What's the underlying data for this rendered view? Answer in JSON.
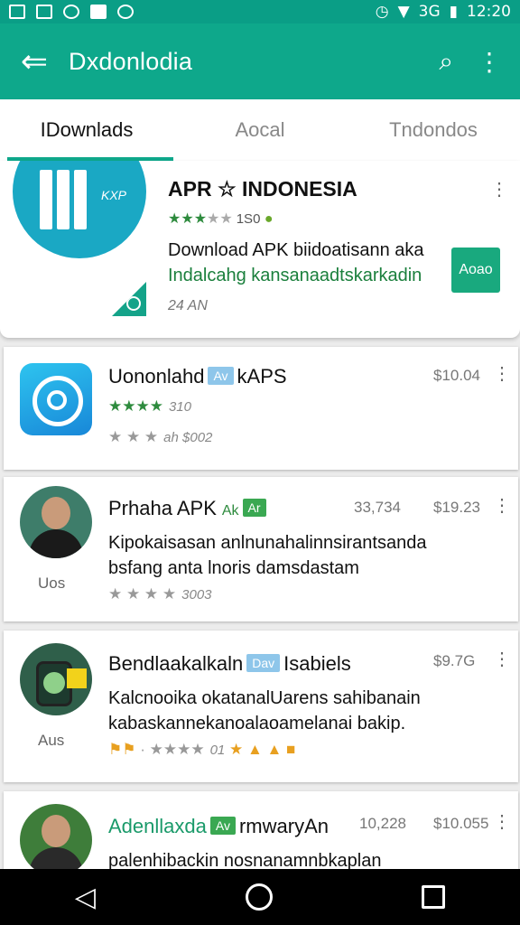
{
  "status": {
    "time": "12:20",
    "signal_text": "3G"
  },
  "appbar": {
    "title": "Dxdonlodia"
  },
  "tabs": [
    {
      "label": "IDownlads"
    },
    {
      "label": "Aocal"
    },
    {
      "label": "Tndondos"
    }
  ],
  "featured": {
    "title": "APR ☆ INDONESIA",
    "rating_count": "1S0",
    "line1": "Download APK biidoatisann aka",
    "line2": "Indalcahg kansanaadtskarkadin",
    "size": "24 AN",
    "button": "Aoao",
    "image_text": "KXP"
  },
  "items": [
    {
      "title": "Uononlahd",
      "badge": "Av",
      "title2": "kAPS",
      "price": "$10.04",
      "rating_text": "310",
      "sub_text": "ah $002"
    },
    {
      "title": "Prhaha APK",
      "badge_pre": "Ak",
      "badge": "Ar",
      "meta": "33,734",
      "price": "$19.23",
      "desc1": "Kipokaisasan anlnunahalinnsirantsanda",
      "desc2": "bsfang anta lnoris damsdastam",
      "rating_text": "3003",
      "side_label": "Uos"
    },
    {
      "title": "Bendlaakalkaln",
      "badge": "Dav",
      "title2": "Isabiels",
      "price": "$9.7G",
      "desc1": "Kalcnooika okatanalUarens sahibanain",
      "desc2": "kabaskannekanoalaoamelanai bakip.",
      "rating_text": "01",
      "side_label": "Aus"
    },
    {
      "title": "Adenllaxda",
      "badge": "Av",
      "title2": "rmwaryAn",
      "meta": "10,228",
      "price": "$10.055",
      "desc1": "palenhibackin nosnanamnbkaplan"
    }
  ]
}
